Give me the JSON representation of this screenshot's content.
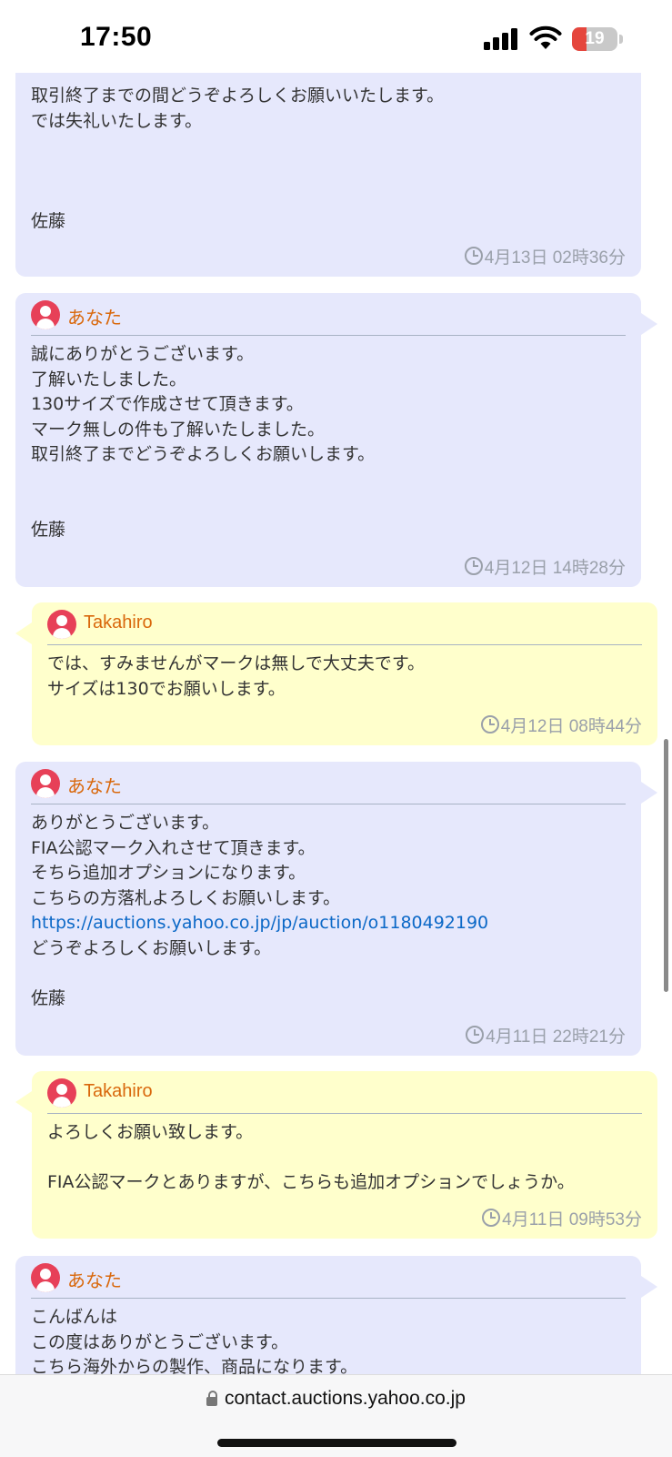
{
  "status_bar": {
    "time": "17:50",
    "battery_level": "19",
    "battery_color": "#e5463d",
    "icons": [
      "cellular-signal-icon",
      "wifi-icon",
      "battery-icon"
    ]
  },
  "messages": [
    {
      "side": "mine",
      "lines": [
        "取引終了までの間どうぞよろしくお願いいたします。",
        "では失礼いたします。",
        "",
        "",
        "",
        "佐藤"
      ],
      "timestamp": "4月13日 02時36分"
    },
    {
      "side": "mine",
      "sender": "あなた",
      "lines": [
        "誠にありがとうございます。",
        "了解いたしました。",
        "130サイズで作成させて頂きます。",
        "マーク無しの件も了解いたしました。",
        "取引終了までどうぞよろしくお願いします。",
        "",
        "",
        "佐藤"
      ],
      "timestamp": "4月12日 14時28分"
    },
    {
      "side": "theirs",
      "sender": "Takahiro",
      "lines": [
        "では、すみませんがマークは無しで大丈夫です。",
        "サイズは130でお願いします。"
      ],
      "timestamp": "4月12日 08時44分"
    },
    {
      "side": "mine",
      "sender": "あなた",
      "lines": [
        "ありがとうございます。",
        "FIA公認マーク入れさせて頂きます。",
        "そちら追加オプションになります。",
        "こちらの方落札よろしくお願いします。",
        "https://auctions.yahoo.co.jp/jp/auction/o1180492190",
        "どうぞよろしくお願いします。",
        "",
        "佐藤"
      ],
      "timestamp": "4月11日 22時21分"
    },
    {
      "side": "theirs",
      "sender": "Takahiro",
      "lines": [
        "よろしくお願い致します。",
        "",
        "FIA公認マークとありますが、こちらも追加オプションでしょうか。"
      ],
      "timestamp": "4月11日 09時53分"
    },
    {
      "side": "mine",
      "sender": "あなた",
      "lines": [
        "こんばんは",
        "この度はありがとうございます。",
        "こちら海外からの製作、商品になります。"
      ]
    }
  ],
  "browser": {
    "url": "contact.auctions.yahoo.co.jp"
  },
  "colors": {
    "mine_bubble": "#e6e8fc",
    "theirs_bubble": "#ffffcc",
    "sender_name": "#d9680c",
    "avatar": "#e74058",
    "link": "#0b68c7",
    "timestamp": "#9aa0aa"
  }
}
